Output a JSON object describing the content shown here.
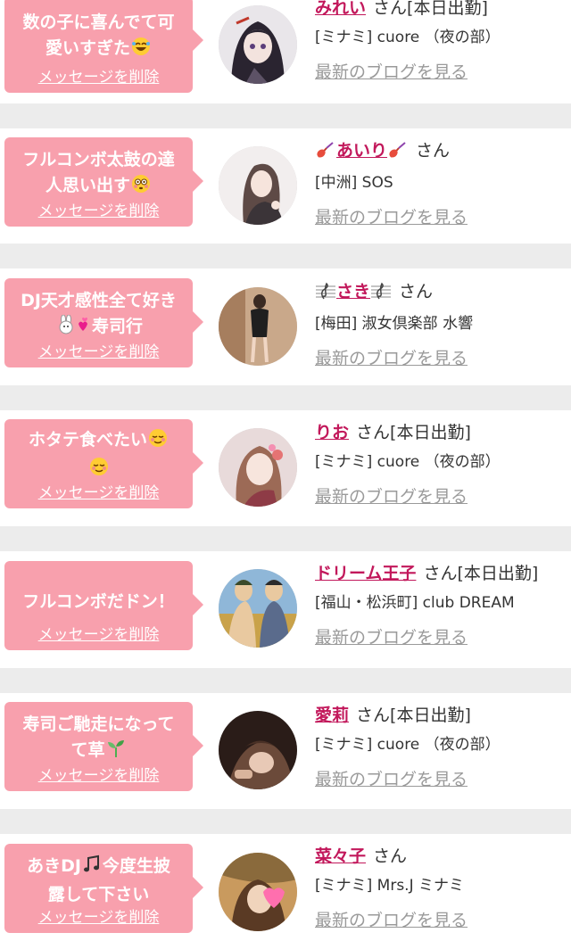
{
  "delete_label": "メッセージを削除",
  "blog_label": "最新のブログを見る",
  "san_label": "さん",
  "accent_pink": "#f8a0ad",
  "name_color": "#c2185b",
  "items": [
    {
      "message_line1": "数の子に喜んでて可",
      "message_line2": "愛いすぎた",
      "message_emoji": "rolling-laughing-emoji",
      "name": "みれい",
      "name_icon": "",
      "shift": "[本日出勤]",
      "shop": "[ミナミ] cuore （夜の部）"
    },
    {
      "message_line1": "フルコンボ太鼓の達",
      "message_line2": "人思い出す",
      "message_emoji": "flushed-face-emoji",
      "name": "あいり",
      "name_icon": "guitar-icon",
      "shift": "",
      "shop": "[中洲] SOS"
    },
    {
      "message_line1": "DJ天才感性全て好き",
      "message_line2": "寿司行",
      "message_emoji": "rabbit-hearts-emoji",
      "name": "さき",
      "name_icon": "music-staff-icon",
      "shift": "",
      "shop": "[梅田] 淑女倶楽部 水響"
    },
    {
      "message_line1": "ホタテ食べたい",
      "message_line2": "",
      "message_emoji": "relieved-face-emoji",
      "name": "りお",
      "name_icon": "",
      "shift": "[本日出勤]",
      "shop": "[ミナミ] cuore （夜の部）"
    },
    {
      "message_line1": "フルコンボだドン！",
      "message_line2": "",
      "message_emoji": "",
      "name": "ドリーム王子",
      "name_icon": "",
      "shift": "[本日出勤]",
      "shop": "[福山・松浜町]  club DREAM"
    },
    {
      "message_line1": "寿司ご馳走になって",
      "message_line2": "て草",
      "message_emoji": "seedling-emoji",
      "name": "愛莉",
      "name_icon": "",
      "shift": "[本日出勤]",
      "shop": "[ミナミ] cuore （夜の部）"
    },
    {
      "message_line1": "あきDJ",
      "message_line1_tail": "今度生披",
      "message_line2": "露して下さい",
      "message_emoji": "musical-notes-emoji",
      "name": "菜々子",
      "name_icon": "",
      "shift": "",
      "shop": "[ミナミ] Mrs.J ミナミ"
    }
  ]
}
